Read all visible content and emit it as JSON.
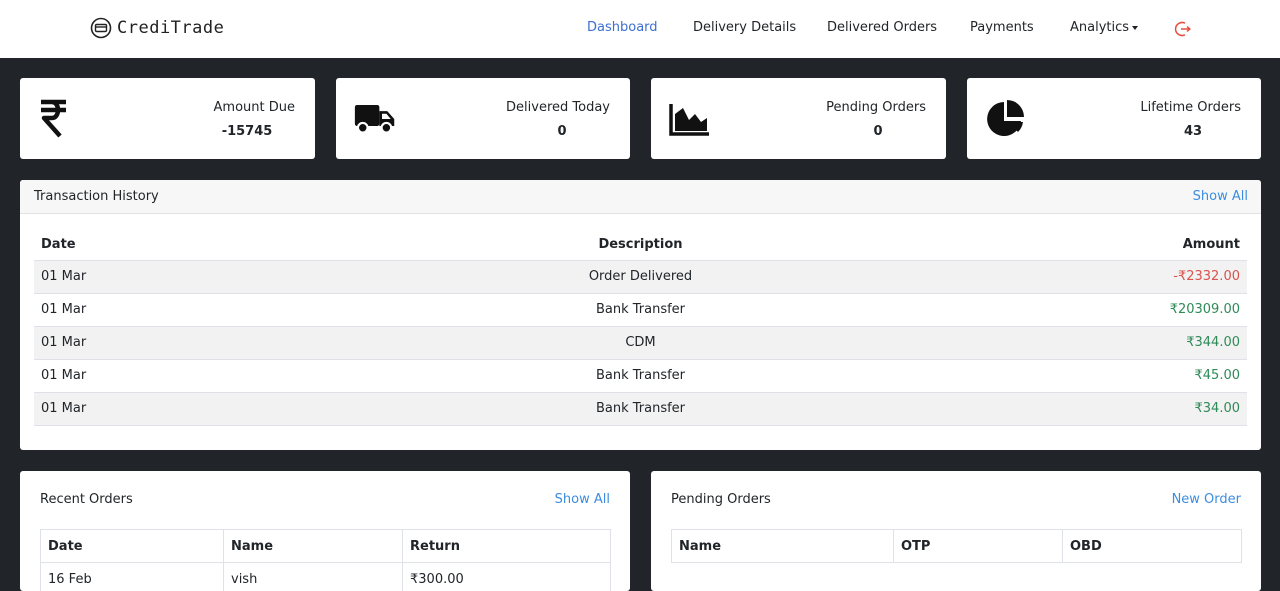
{
  "brand": {
    "name": "CrediTrade",
    "icon": "credit-card-circle-icon"
  },
  "nav": {
    "dashboard": "Dashboard",
    "delivery_details": "Delivery Details",
    "delivered_orders": "Delivered Orders",
    "payments": "Payments",
    "analytics": "Analytics",
    "logout_icon": "logout-icon",
    "active_color": "#3c6fd1",
    "logout_color": "#e74c3c"
  },
  "stats": [
    {
      "label": "Amount Due",
      "value": "-15745",
      "icon": "rupee-icon"
    },
    {
      "label": "Delivered Today",
      "value": "0",
      "icon": "truck-icon"
    },
    {
      "label": "Pending Orders",
      "value": "0",
      "icon": "area-chart-icon"
    },
    {
      "label": "Lifetime Orders",
      "value": "43",
      "icon": "pie-chart-icon"
    }
  ],
  "transactions": {
    "title": "Transaction History",
    "show_all": "Show All",
    "columns": {
      "date": "Date",
      "description": "Description",
      "amount": "Amount"
    },
    "rows": [
      {
        "date": "01 Mar",
        "description": "Order Delivered",
        "amount": "-₹2332.00",
        "type": "debit"
      },
      {
        "date": "01 Mar",
        "description": "Bank Transfer",
        "amount": "₹20309.00",
        "type": "credit"
      },
      {
        "date": "01 Mar",
        "description": "CDM",
        "amount": "₹344.00",
        "type": "credit"
      },
      {
        "date": "01 Mar",
        "description": "Bank Transfer",
        "amount": "₹45.00",
        "type": "credit"
      },
      {
        "date": "01 Mar",
        "description": "Bank Transfer",
        "amount": "₹34.00",
        "type": "credit"
      }
    ],
    "debit_color": "#d9534f",
    "credit_color": "#2e8b57"
  },
  "recent_orders": {
    "title": "Recent Orders",
    "show_all": "Show All",
    "columns": {
      "date": "Date",
      "name": "Name",
      "return": "Return"
    },
    "rows": [
      {
        "date": "16 Feb",
        "name": "vish",
        "return": "₹300.00"
      }
    ]
  },
  "pending_orders": {
    "title": "Pending Orders",
    "new_order": "New Order",
    "columns": {
      "name": "Name",
      "otp": "OTP",
      "obd": "OBD"
    }
  }
}
